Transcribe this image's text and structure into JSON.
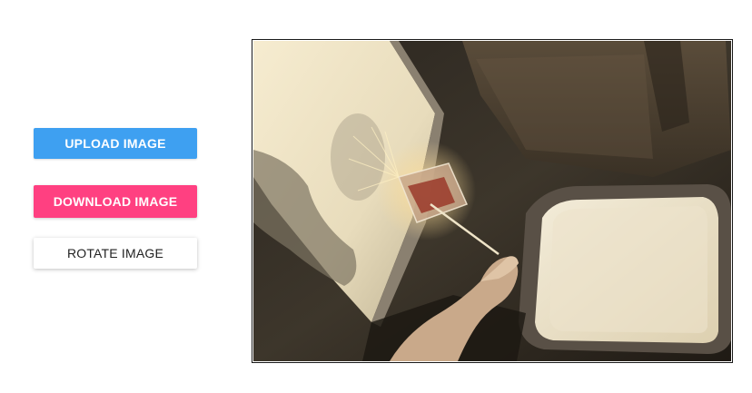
{
  "controls": {
    "upload_label": "UPLOAD IMAGE",
    "download_label": "DOWNLOAD IMAGE",
    "rotate_label": "ROTATE IMAGE"
  },
  "colors": {
    "upload_bg": "#3ea0f1",
    "download_bg": "#ff4081",
    "rotate_bg": "#ffffff"
  },
  "preview": {
    "image_subject": "hand holding a stirrer with a floating glass next to an airplane window"
  }
}
